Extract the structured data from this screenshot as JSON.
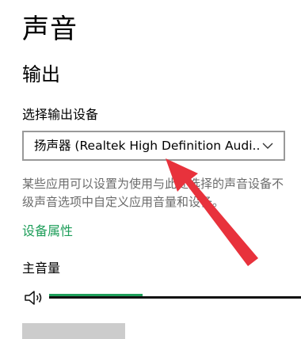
{
  "page": {
    "title": "声音"
  },
  "output": {
    "section_title": "输出",
    "select_label": "选择输出设备",
    "selected_device": "扬声器 (Realtek High Definition Audi...",
    "description_line1": "某些应用可以设置为使用与此处选择的声音设备不",
    "description_line2": "级声音选项中自定义应用音量和设备。",
    "device_properties_link": "设备属性",
    "volume_label": "主音量",
    "volume_level": 0.37
  },
  "icons": {
    "dropdown": "chevron-down-icon",
    "volume": "speaker-icon"
  },
  "colors": {
    "accent": "#1e9e5a",
    "annotation_arrow": "#e8323c"
  }
}
